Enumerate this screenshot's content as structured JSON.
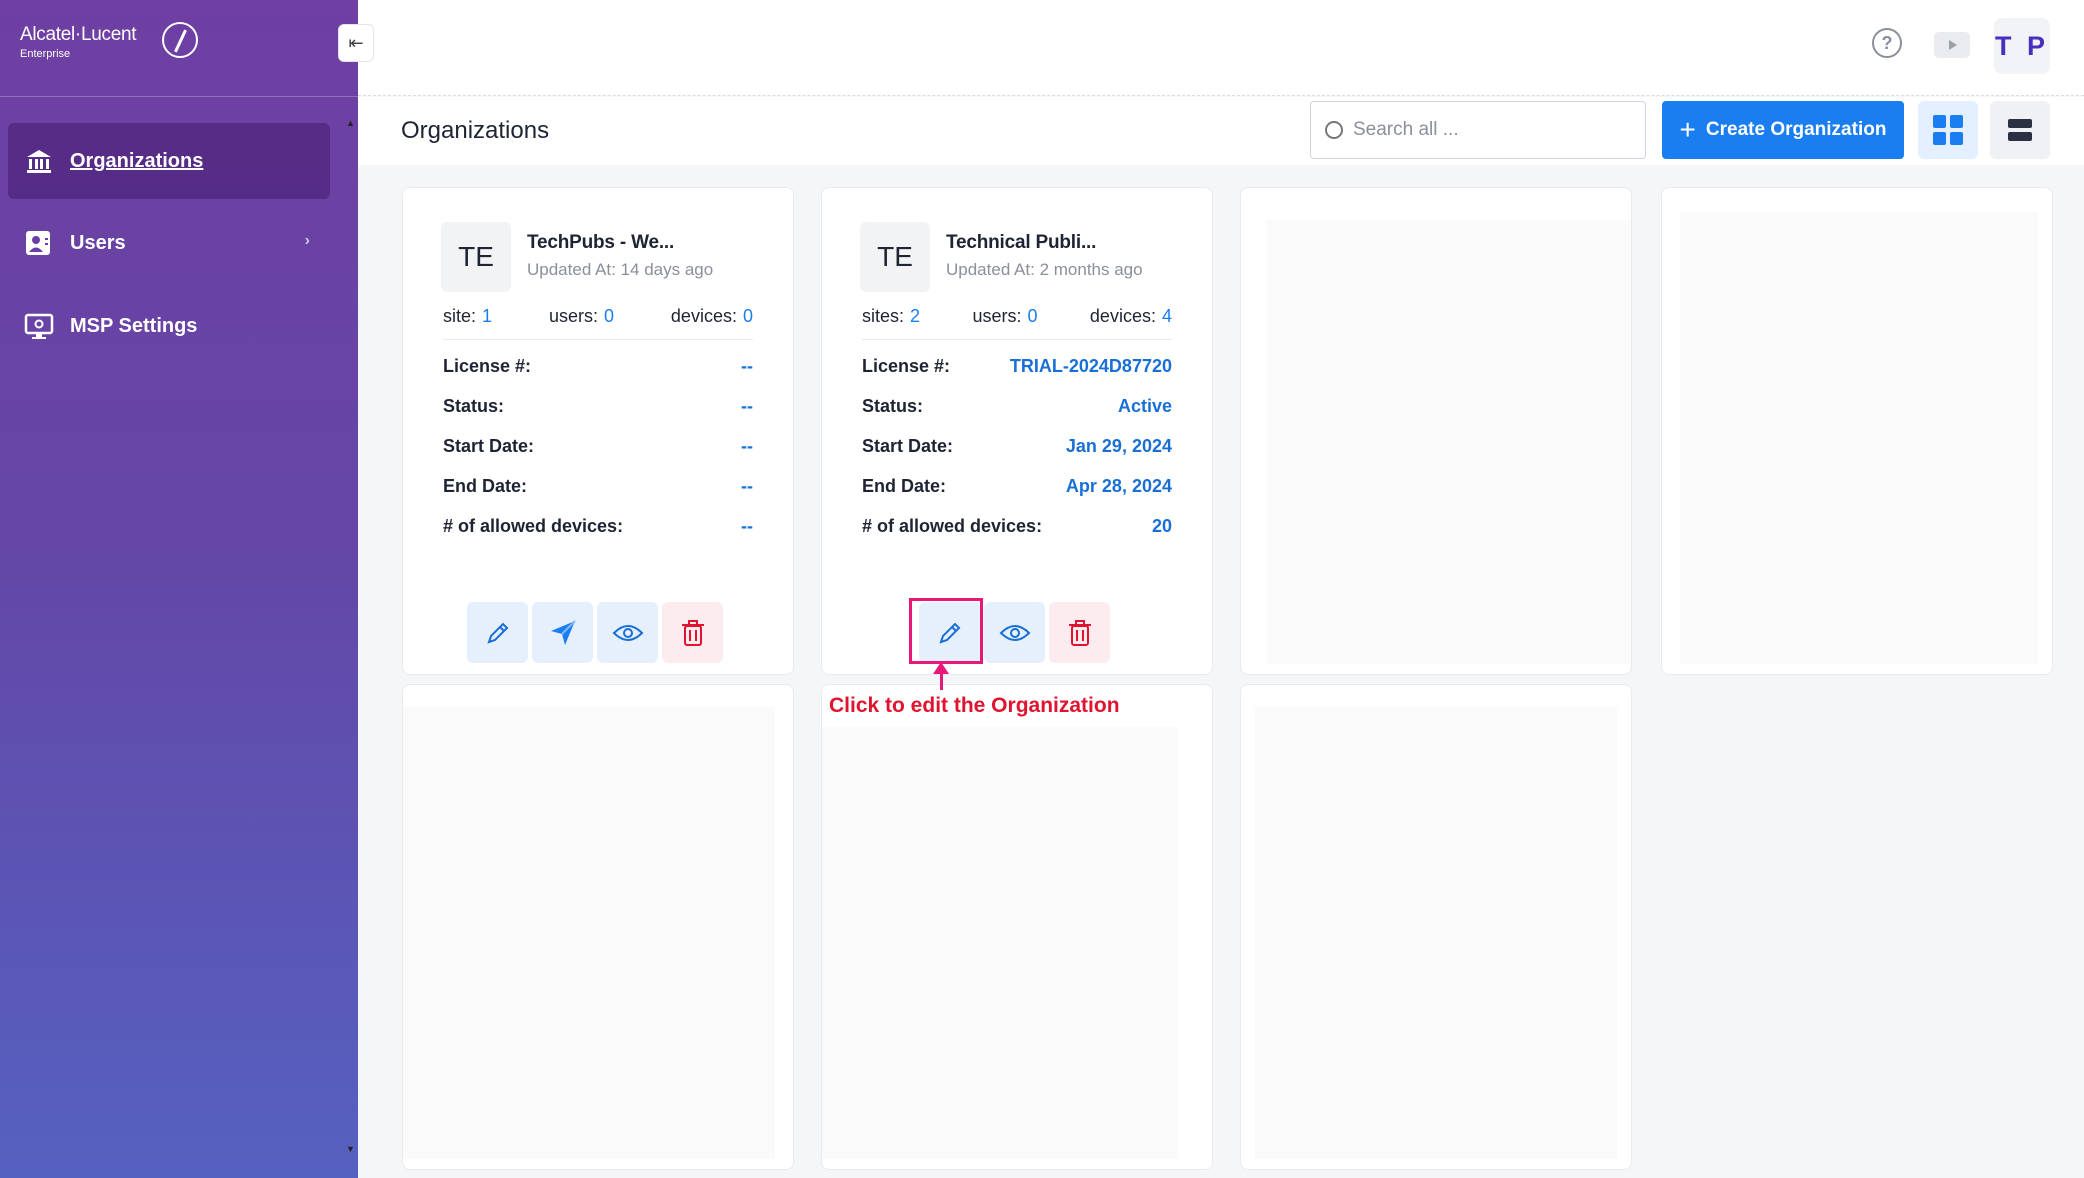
{
  "brand": {
    "name": "Alcatel·Lucent",
    "sub": "Enterprise"
  },
  "sidebar": {
    "items": [
      {
        "label": "Organizations",
        "icon": "bank-icon",
        "active": true
      },
      {
        "label": "Users",
        "icon": "user-card-icon",
        "has_submenu": true
      },
      {
        "label": "MSP Settings",
        "icon": "monitor-settings-icon"
      }
    ]
  },
  "topbar": {
    "avatar_initials": "T P"
  },
  "page": {
    "title": "Organizations"
  },
  "search": {
    "placeholder": "Search all ..."
  },
  "toolbar": {
    "create_label": "Create Organization"
  },
  "cards": [
    {
      "initials": "TE",
      "name": "TechPubs - We...",
      "updated": "Updated At: 14 days ago",
      "stats": [
        {
          "label": "site:",
          "value": "1"
        },
        {
          "label": "users:",
          "value": "0"
        },
        {
          "label": "devices:",
          "value": "0"
        }
      ],
      "info": [
        {
          "label": "License #:",
          "value": "--"
        },
        {
          "label": "Status:",
          "value": "--"
        },
        {
          "label": "Start Date:",
          "value": "--"
        },
        {
          "label": "End Date:",
          "value": "--"
        },
        {
          "label": "# of allowed devices:",
          "value": "--"
        }
      ]
    },
    {
      "initials": "TE",
      "name": "Technical Publi...",
      "updated": "Updated At: 2 months ago",
      "stats": [
        {
          "label": "sites:",
          "value": "2"
        },
        {
          "label": "users:",
          "value": "0"
        },
        {
          "label": "devices:",
          "value": "4"
        }
      ],
      "info": [
        {
          "label": "License #:",
          "value": "TRIAL-2024D87720"
        },
        {
          "label": "Status:",
          "value": "Active"
        },
        {
          "label": "Start Date:",
          "value": "Jan 29, 2024"
        },
        {
          "label": "End Date:",
          "value": "Apr 28, 2024"
        },
        {
          "label": "# of allowed devices:",
          "value": "20"
        }
      ]
    }
  ],
  "annotation": {
    "text": "Click to edit the Organization",
    "color": "#e0142f",
    "highlight_color": "#e6197a"
  },
  "colors": {
    "accent": "#1a7ef0",
    "value_blue": "#1a6fd6",
    "danger": "#e0142f"
  }
}
